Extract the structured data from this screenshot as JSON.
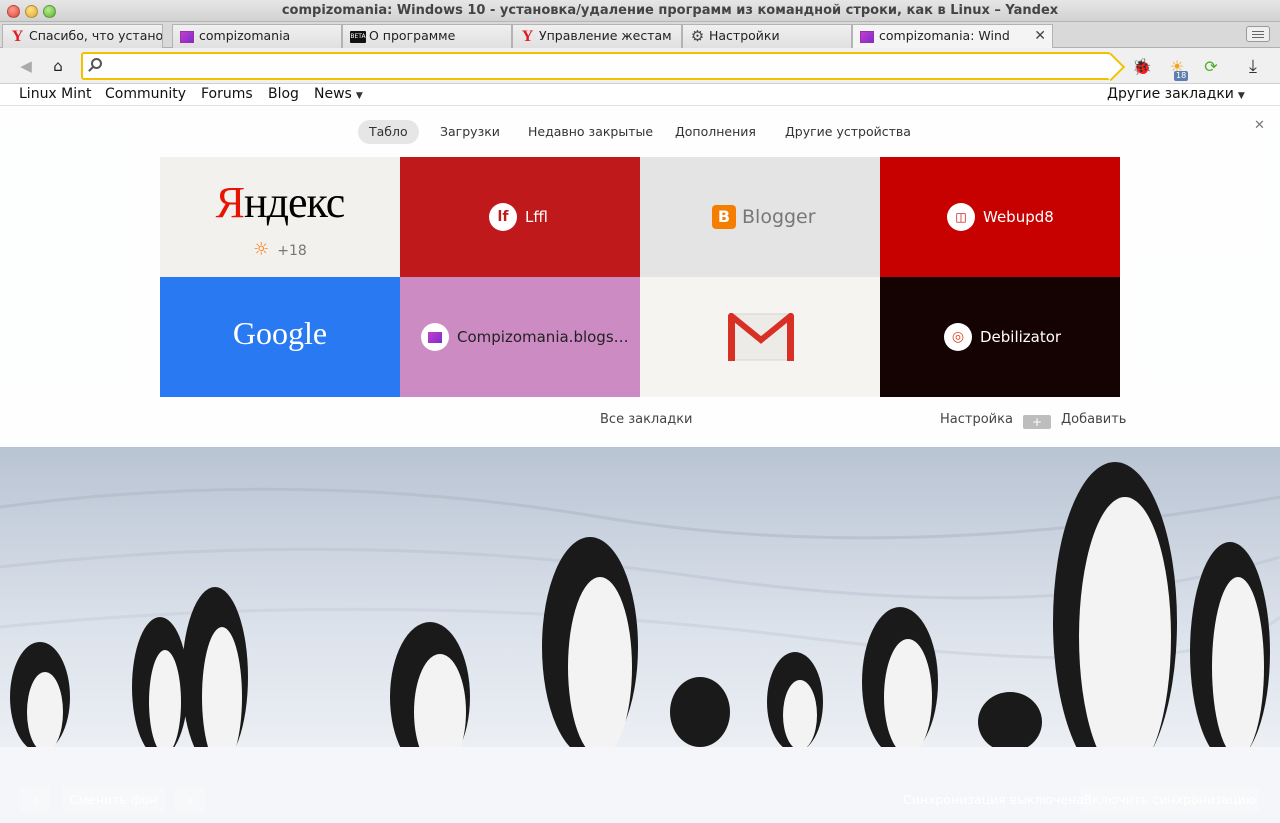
{
  "window": {
    "title": "compizomania: Windows 10 - установка/удаление программ из командной строки, как в Linux – Yandex"
  },
  "tabs": [
    {
      "label": "Спасибо, что устано",
      "icon": "yandex-icon"
    },
    {
      "label": "compizomania",
      "icon": "compizomania-icon"
    },
    {
      "label": "О программе",
      "icon": "beta-icon"
    },
    {
      "label": "Управление жестам",
      "icon": "yandex-icon"
    },
    {
      "label": "Настройки",
      "icon": "gear-icon"
    },
    {
      "label": "compizomania: Wind",
      "icon": "compizomania-icon"
    }
  ],
  "toolbar": {
    "address_value": "",
    "weather_badge": "18"
  },
  "bookmarks": {
    "items": [
      "Linux Mint",
      "Community",
      "Forums",
      "Blog",
      "News"
    ],
    "other": "Другие закладки"
  },
  "newtab": {
    "nav": [
      "Табло",
      "Загрузки",
      "Недавно закрытые",
      "Дополнения",
      "Другие устройства"
    ],
    "tiles": [
      {
        "label": "Яндекс",
        "sub": "+18",
        "bg": "#f3f1ee"
      },
      {
        "label": "Lffl",
        "bg": "#c0191c"
      },
      {
        "label": "Blogger",
        "bg": "#e4e4e4"
      },
      {
        "label": "Webupd8",
        "bg": "#c70000"
      },
      {
        "label": "Google",
        "bg": "#2979f2"
      },
      {
        "label": "Compizomania.blogs…",
        "bg": "#cd8bc3"
      },
      {
        "label": "",
        "bg": "#f6f4f1"
      },
      {
        "label": "Debilizator",
        "bg": "#150303"
      }
    ],
    "all_bookmarks": "Все закладки",
    "settings": "Настройка",
    "add": "Добавить"
  },
  "footer": {
    "change_bg": "Сменить фон",
    "sync_status": "Синхронизация выключена",
    "enable_sync": "Включить синхронизацию"
  }
}
